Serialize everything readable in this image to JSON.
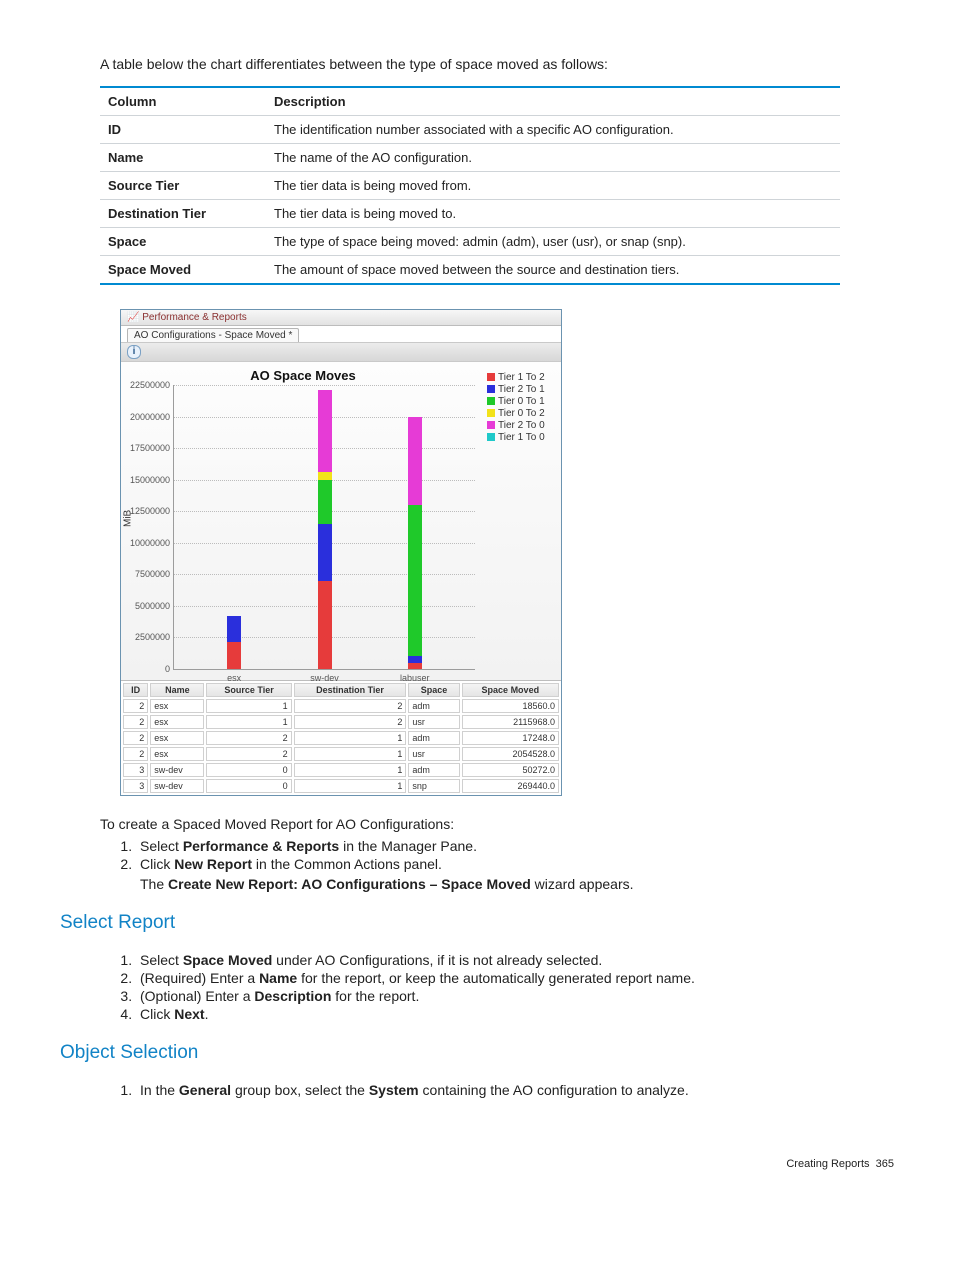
{
  "intro": "A table below the chart differentiates between the type of space moved as follows:",
  "table_header": {
    "c1": "Column",
    "c2": "Description"
  },
  "table_rows": [
    {
      "c": "ID",
      "d": "The identification number associated with a specific AO configuration."
    },
    {
      "c": "Name",
      "d": "The name of the AO configuration."
    },
    {
      "c": "Source Tier",
      "d": "The tier data is being moved from."
    },
    {
      "c": "Destination Tier",
      "d": "The tier data is being moved to."
    },
    {
      "c": "Space",
      "d": "The type of space being moved: admin (adm), user (usr), or snap (snp)."
    },
    {
      "c": "Space Moved",
      "d": "The amount of space moved between the source and destination tiers."
    }
  ],
  "screenshot": {
    "window_title": "Performance & Reports",
    "tab": "AO Configurations - Space Moved *",
    "chart_title": "AO Space Moves",
    "ylabel": "MiB",
    "legend": [
      {
        "name": "Tier 1 To 2",
        "color": "#e63b3b"
      },
      {
        "name": "Tier 2 To 1",
        "color": "#2a2fdc"
      },
      {
        "name": "Tier 0 To 1",
        "color": "#1fc92a"
      },
      {
        "name": "Tier 0 To 2",
        "color": "#f2e21a"
      },
      {
        "name": "Tier 2 To 0",
        "color": "#e63bd6"
      },
      {
        "name": "Tier 1 To 0",
        "color": "#1fc9c9"
      }
    ],
    "table_cols": [
      "ID",
      "Name",
      "Source Tier",
      "Destination Tier",
      "Space",
      "Space Moved"
    ],
    "table_rows": [
      [
        "2",
        "esx",
        "1",
        "2",
        "adm",
        "18560.0"
      ],
      [
        "2",
        "esx",
        "1",
        "2",
        "usr",
        "2115968.0"
      ],
      [
        "2",
        "esx",
        "2",
        "1",
        "adm",
        "17248.0"
      ],
      [
        "2",
        "esx",
        "2",
        "1",
        "usr",
        "2054528.0"
      ],
      [
        "3",
        "sw-dev",
        "0",
        "1",
        "adm",
        "50272.0"
      ],
      [
        "3",
        "sw-dev",
        "0",
        "1",
        "snp",
        "269440.0"
      ]
    ]
  },
  "chart_data": {
    "type": "bar",
    "stacked": true,
    "ylabel": "MiB",
    "ylim": [
      0,
      22500000
    ],
    "yticks": [
      0,
      2500000,
      5000000,
      7500000,
      10000000,
      12500000,
      15000000,
      17500000,
      20000000,
      22500000
    ],
    "categories": [
      "esx",
      "sw-dev",
      "labuser"
    ],
    "series": [
      {
        "name": "Tier 1 To 2",
        "color": "#e63b3b",
        "values": [
          2134528,
          7000000,
          500000
        ]
      },
      {
        "name": "Tier 2 To 1",
        "color": "#2a2fdc",
        "values": [
          2071776,
          4500000,
          500000
        ]
      },
      {
        "name": "Tier 0 To 1",
        "color": "#1fc92a",
        "values": [
          0,
          3500000,
          12000000
        ]
      },
      {
        "name": "Tier 0 To 2",
        "color": "#f2e21a",
        "values": [
          0,
          600000,
          0
        ]
      },
      {
        "name": "Tier 2 To 0",
        "color": "#e63bd6",
        "values": [
          0,
          6500000,
          7000000
        ]
      },
      {
        "name": "Tier 1 To 0",
        "color": "#1fc9c9",
        "values": [
          0,
          0,
          0
        ]
      }
    ]
  },
  "step_intro": "To create a Spaced Moved Report for AO Configurations:",
  "steps1": {
    "s1a": "Select ",
    "s1b": "Performance & Reports",
    "s1c": " in the Manager Pane.",
    "s2a": "Click ",
    "s2b": "New Report",
    "s2c": " in the Common Actions panel.",
    "s2d_a": "The ",
    "s2d_b": "Create New Report: AO Configurations – Space Moved",
    "s2d_c": " wizard appears."
  },
  "h_select": "Select Report",
  "steps2": {
    "s1a": "Select ",
    "s1b": "Space Moved",
    "s1c": " under AO Configurations, if it is not already selected.",
    "s2a": "(Required) Enter a ",
    "s2b": "Name",
    "s2c": " for the report, or keep the automatically generated report name.",
    "s3a": "(Optional) Enter a ",
    "s3b": "Description",
    "s3c": " for the report.",
    "s4a": "Click ",
    "s4b": "Next",
    "s4c": "."
  },
  "h_object": "Object Selection",
  "steps3": {
    "s1a": "In the ",
    "s1b": "General",
    "s1c": " group box, select the ",
    "s1d": "System",
    "s1e": " containing the AO configuration to analyze."
  },
  "footer_label": "Creating Reports",
  "footer_page": "365"
}
